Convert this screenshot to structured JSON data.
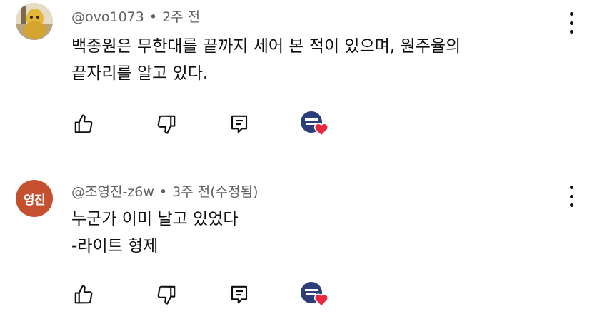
{
  "comments": [
    {
      "author": "@ovo1073",
      "time": "2주 전",
      "lines": [
        "백종원은 무한대를 끝까지 세어 본 적이 있으며, 원주율의",
        "끝자리를 알고 있다."
      ],
      "avatar_icon": "user-photo-avatar"
    },
    {
      "author": "@조영진-z6w",
      "time": "3주 전(수정됨)",
      "lines": [
        "누군가 이미 날고 있었다",
        "-라이트 형제"
      ],
      "avatar_text": "영진",
      "avatar_color": "#c5502f"
    }
  ],
  "separator": "•",
  "colors": {
    "meta": "#606060",
    "text": "#0f0f0f",
    "heart": "#e8283c",
    "badge": "#2c3e7a"
  }
}
